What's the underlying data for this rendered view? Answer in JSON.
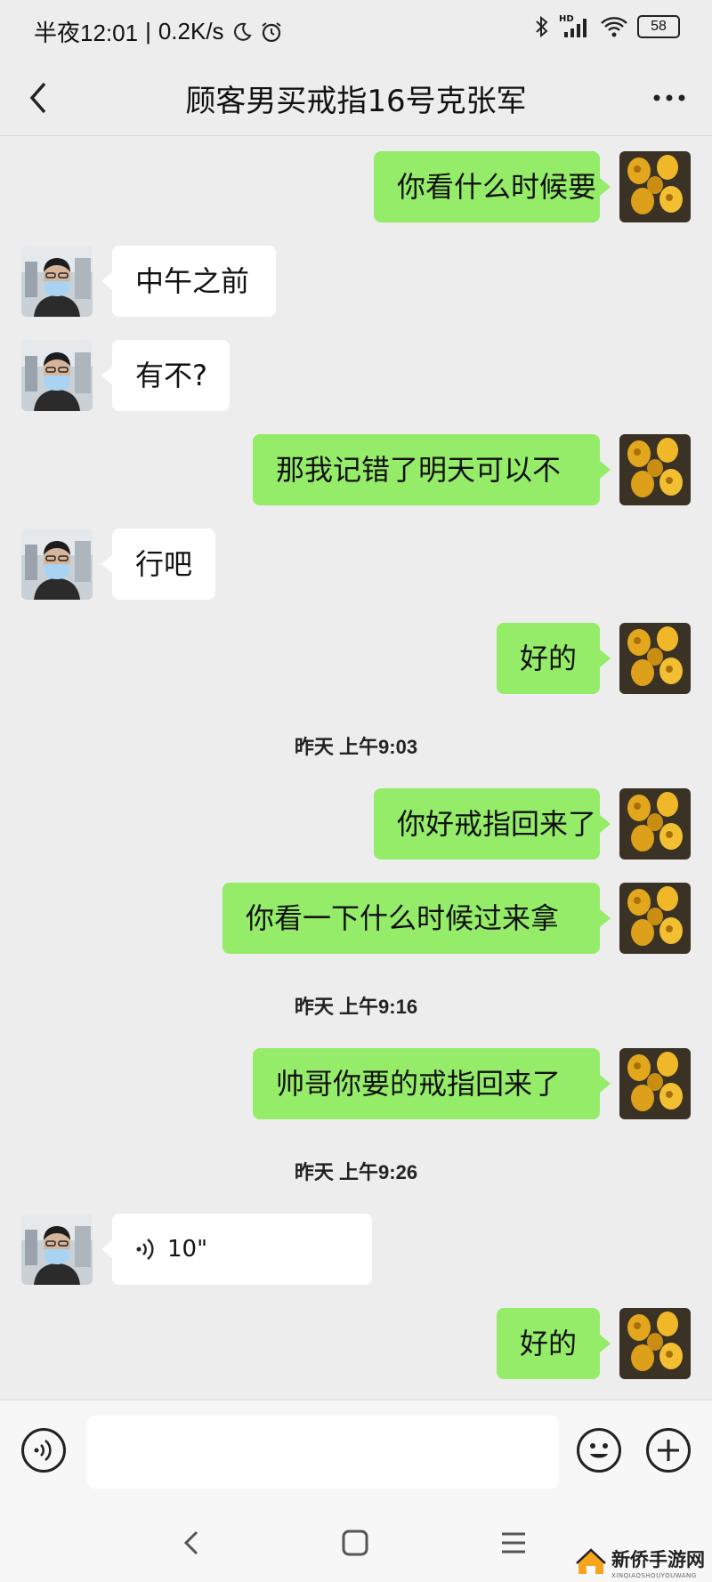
{
  "status_bar": {
    "time": "半夜12:01",
    "speed": "0.2K/s",
    "battery": "58",
    "hd": "HD"
  },
  "header": {
    "title": "顾客男买戒指16号克张军"
  },
  "colors": {
    "outgoing_bubble": "#95ec69",
    "incoming_bubble": "#ffffff",
    "background": "#ededed"
  },
  "messages": [
    {
      "dir": "out",
      "text": "你看什么时候要"
    },
    {
      "dir": "in",
      "text": "中午之前"
    },
    {
      "dir": "in",
      "text": "有不?"
    },
    {
      "dir": "out",
      "text": "那我记错了明天可以不"
    },
    {
      "dir": "in",
      "text": "行吧"
    },
    {
      "dir": "out",
      "text": "好的"
    },
    {
      "dir": "out",
      "text": "你好戒指回来了"
    },
    {
      "dir": "out",
      "text": "你看一下什么时候过来拿"
    },
    {
      "dir": "out",
      "text": "帅哥你要的戒指回来了"
    },
    {
      "dir": "in",
      "type": "voice",
      "text": "10\""
    },
    {
      "dir": "out",
      "text": "好的"
    }
  ],
  "timestamps": [
    "昨天 上午9:03",
    "昨天 上午9:16",
    "昨天 上午9:26"
  ],
  "input_bar": {
    "voice_icon": "voice-icon",
    "emoji_icon": "emoji-icon",
    "plus_icon": "plus-icon"
  },
  "watermark": {
    "name": "新侨手游网",
    "sub": "XINQIAOSHOUYOUWANG"
  }
}
